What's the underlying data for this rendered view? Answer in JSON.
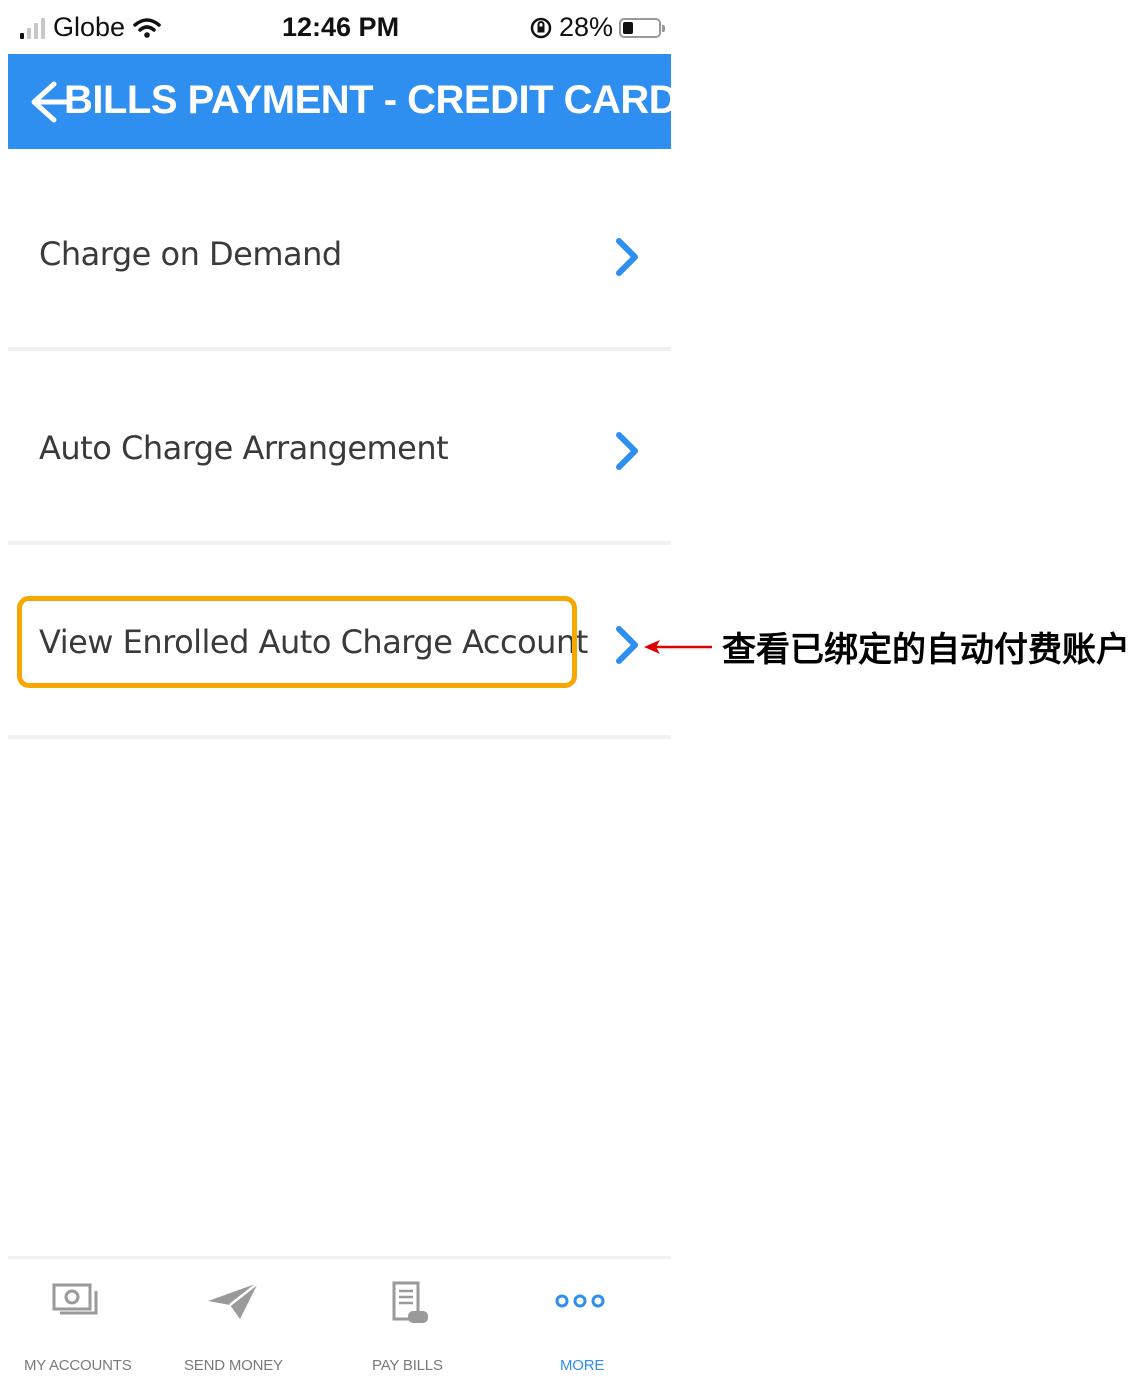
{
  "status_bar": {
    "carrier": "Globe",
    "time": "12:46 PM",
    "battery": "28%",
    "battery_level": 0.28
  },
  "header": {
    "title": "BILLS PAYMENT - CREDIT CARD",
    "back_icon": "arrow-left-icon",
    "background": "#2f8ff0"
  },
  "menu": {
    "items": [
      {
        "label": "Charge on Demand",
        "icon": "chevron-right-icon"
      },
      {
        "label": "Auto Charge Arrangement",
        "icon": "chevron-right-icon"
      },
      {
        "label": "View Enrolled Auto Charge Account",
        "icon": "chevron-right-icon",
        "highlighted": true
      }
    ]
  },
  "annotation": {
    "text": "查看已绑定的自动付费账户",
    "arrow_color": "#e00000",
    "highlight_color": "#f6a800"
  },
  "tab_bar": {
    "tabs": [
      {
        "label": "MY ACCOUNTS",
        "icon": "wallet-icon"
      },
      {
        "label": "SEND MONEY",
        "icon": "paper-plane-icon"
      },
      {
        "label": "PAY BILLS",
        "icon": "bill-icon"
      },
      {
        "label": "MORE",
        "icon": "more-dots-icon",
        "active": true
      }
    ],
    "active_color": "#2f8ff0"
  }
}
